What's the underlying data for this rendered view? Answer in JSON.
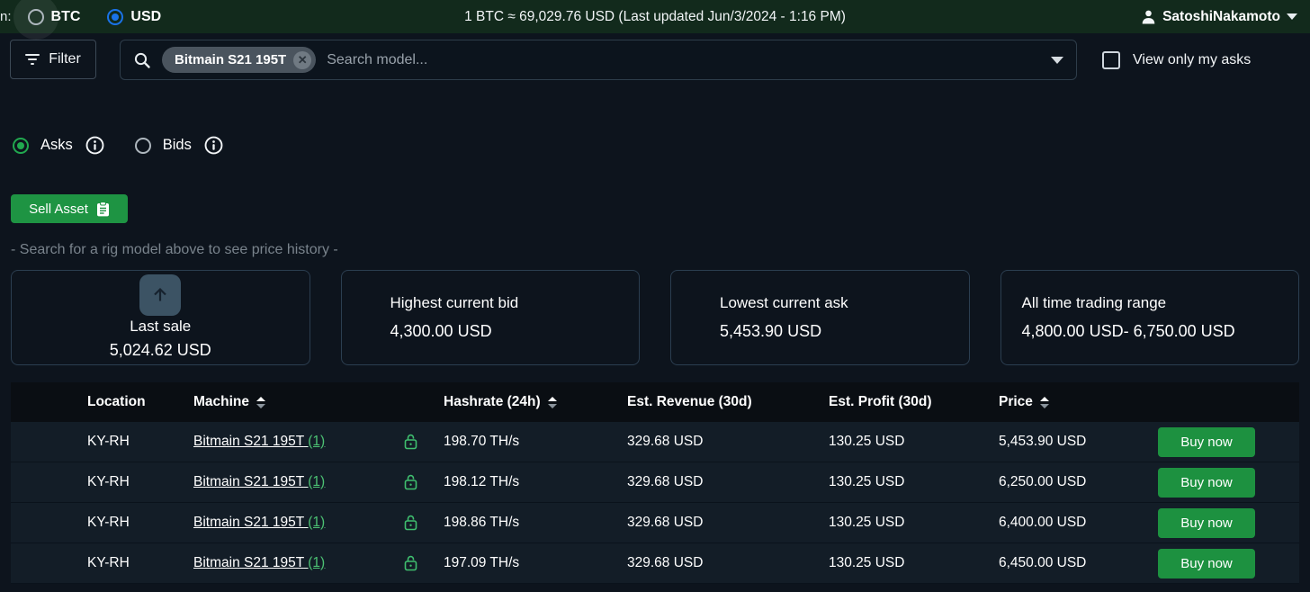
{
  "colors": {
    "topbar_green": "#122a1c",
    "accent_green": "#1e9443",
    "link_green": "#4cc173",
    "radio_blue": "#1a73e8",
    "asks_radio_green": "#21a84f"
  },
  "topbar": {
    "cut_label": "n:",
    "currencies": [
      {
        "label": "BTC",
        "selected": false
      },
      {
        "label": "USD",
        "selected": true
      }
    ],
    "rate_text": "1 BTC ≈ 69,029.76 USD (Last updated Jun/3/2024 - 1:16 PM)",
    "user_name": "SatoshiNakamoto"
  },
  "toolbar": {
    "filter_label": "Filter",
    "search_chip": "Bitmain S21 195T",
    "chip_close": "✕",
    "search_placeholder": "Search model...",
    "view_only_label": "View only my asks"
  },
  "mode": {
    "asks_label": "Asks",
    "bids_label": "Bids"
  },
  "actions": {
    "sell_asset_label": "Sell Asset"
  },
  "hint": "- Search for a rig model above to see price history -",
  "stats": [
    {
      "label": "Last sale",
      "value": "5,024.62 USD"
    },
    {
      "label": "Highest current bid",
      "value": "4,300.00 USD"
    },
    {
      "label": "Lowest current ask",
      "value": "5,453.90 USD"
    },
    {
      "label": "All time trading range",
      "value": "4,800.00 USD- 6,750.00 USD"
    }
  ],
  "table": {
    "headers": {
      "location": "Location",
      "machine": "Machine",
      "hashrate": "Hashrate (24h)",
      "revenue": "Est. Revenue (30d)",
      "profit": "Est. Profit (30d)",
      "price": "Price"
    },
    "buy_label": "Buy now",
    "rows": [
      {
        "location": "KY-RH",
        "machine": "Bitmain S21 195T",
        "count": "(1)",
        "hashrate": "198.70 TH/s",
        "revenue": "329.68 USD",
        "profit": "130.25 USD",
        "price": "5,453.90 USD"
      },
      {
        "location": "KY-RH",
        "machine": "Bitmain S21 195T",
        "count": "(1)",
        "hashrate": "198.12 TH/s",
        "revenue": "329.68 USD",
        "profit": "130.25 USD",
        "price": "6,250.00 USD"
      },
      {
        "location": "KY-RH",
        "machine": "Bitmain S21 195T",
        "count": "(1)",
        "hashrate": "198.86 TH/s",
        "revenue": "329.68 USD",
        "profit": "130.25 USD",
        "price": "6,400.00 USD"
      },
      {
        "location": "KY-RH",
        "machine": "Bitmain S21 195T",
        "count": "(1)",
        "hashrate": "197.09 TH/s",
        "revenue": "329.68 USD",
        "profit": "130.25 USD",
        "price": "6,450.00 USD"
      }
    ]
  }
}
